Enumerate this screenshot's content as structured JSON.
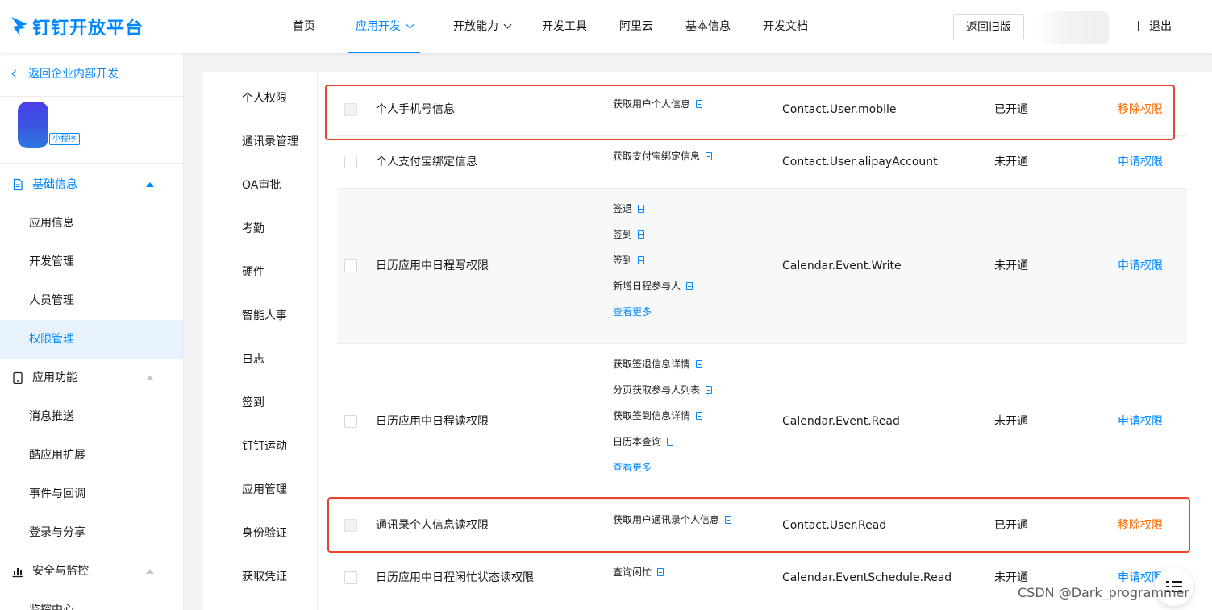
{
  "header": {
    "logo_text": "钉钉开放平台",
    "nav": [
      {
        "label": "首页"
      },
      {
        "label": "应用开发"
      },
      {
        "label": "开放能力"
      },
      {
        "label": "开发工具"
      },
      {
        "label": "阿里云"
      },
      {
        "label": "基本信息"
      },
      {
        "label": "开发文档"
      }
    ],
    "old_version_button": "返回旧版",
    "logout": "退出",
    "colors": {
      "brand": "#0089ff"
    }
  },
  "sidebar": {
    "back_link": "返回企业内部开发",
    "app_tag": "小程序",
    "groups": {
      "basic": {
        "label": "基础信息",
        "icon": "document-icon"
      },
      "functions": {
        "label": "应用功能",
        "icon": "phone-icon"
      },
      "security": {
        "label": "安全与监控",
        "icon": "bar-chart-icon"
      }
    },
    "items": [
      "应用信息",
      "开发管理",
      "人员管理",
      "权限管理",
      "消息推送",
      "酷应用扩展",
      "事件与回调",
      "登录与分享",
      "监控中心"
    ],
    "active_item": "权限管理"
  },
  "categories": [
    "个人权限",
    "通讯录管理",
    "OA审批",
    "考勤",
    "硬件",
    "智能人事",
    "日志",
    "签到",
    "钉钉运动",
    "应用管理",
    "身份验证",
    "获取凭证"
  ],
  "permissions": [
    {
      "name": "个人手机号信息",
      "apis": [
        "获取用户个人信息"
      ],
      "code": "Contact.User.mobile",
      "status": "已开通",
      "action": "移除权限"
    },
    {
      "name": "个人支付宝绑定信息",
      "apis": [
        "获取支付宝绑定信息"
      ],
      "code": "Contact.User.alipayAccount",
      "status": "未开通",
      "action": "申请权限"
    },
    {
      "name": "日历应用中日程写权限",
      "apis": [
        "签退",
        "签到",
        "签到",
        "新增日程参与人"
      ],
      "more": "查看更多",
      "code": "Calendar.Event.Write",
      "status": "未开通",
      "action": "申请权限"
    },
    {
      "name": "日历应用中日程读权限",
      "apis": [
        "获取签退信息详情",
        "分页获取参与人列表",
        "获取签到信息详情",
        "日历本查询"
      ],
      "more": "查看更多",
      "code": "Calendar.Event.Read",
      "status": "未开通",
      "action": "申请权限"
    },
    {
      "name": "通讯录个人信息读权限",
      "apis": [
        "获取用户通讯录个人信息"
      ],
      "code": "Contact.User.Read",
      "status": "已开通",
      "action": "移除权限"
    },
    {
      "name": "日历应用中日程闲忙状态读权限",
      "apis": [
        "查询闲忙"
      ],
      "code": "Calendar.EventSchedule.Read",
      "status": "未开通",
      "action": "申请权限"
    }
  ],
  "watermark": "CSDN @Dark_programmer"
}
